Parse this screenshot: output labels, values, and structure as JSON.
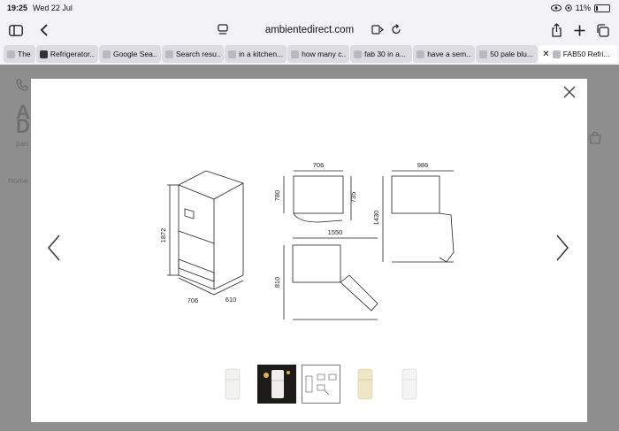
{
  "status_bar": {
    "time": "19:25",
    "date": "Wed 22 Jul",
    "battery": "11%"
  },
  "toolbar": {
    "address": "ambientedirect.com"
  },
  "tabs": [
    {
      "label": "The"
    },
    {
      "label": "Refrigerator..."
    },
    {
      "label": "Google Sea..."
    },
    {
      "label": "Search resu..."
    },
    {
      "label": "in a kitchen..."
    },
    {
      "label": "how many c..."
    },
    {
      "label": "fab 30 in a..."
    },
    {
      "label": "have a sem..."
    },
    {
      "label": "50 pale blu..."
    },
    {
      "label": "FAB50 Refri..."
    }
  ],
  "background_page": {
    "logo": "A\nDI",
    "subtitle": "part",
    "breadcrumb": "Home"
  },
  "dimensions": {
    "front_height": "1872",
    "depth": "706",
    "width": "610",
    "top_width": "706",
    "side_height_1": "780",
    "side_height_2": "735",
    "open_width_top": "986",
    "open_height": "1430",
    "open_width_total": "1550",
    "open_depth": "810"
  },
  "thumbnails": [
    {
      "name": "white-fridge"
    },
    {
      "name": "fridge-in-room"
    },
    {
      "name": "dimension-drawing",
      "selected": true
    },
    {
      "name": "cream-fridge"
    },
    {
      "name": "white-fridge-front"
    }
  ]
}
